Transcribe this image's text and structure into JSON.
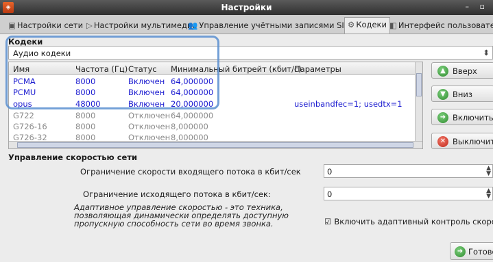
{
  "window": {
    "title": "Настройки",
    "controls": "– ▫"
  },
  "tabs": [
    {
      "label": "Настройки сети",
      "icon": "network-icon",
      "glyph": "▣"
    },
    {
      "label": "Настройки мультимедиа",
      "icon": "play-icon",
      "glyph": "▷"
    },
    {
      "label": "Управление учётными записями SIP",
      "icon": "accounts-icon",
      "glyph": "👥"
    },
    {
      "label": "Кодеки",
      "icon": "codecs-icon",
      "glyph": "⚙"
    },
    {
      "label": "Интерфейс пользователя",
      "icon": "interface-icon",
      "glyph": "◧"
    }
  ],
  "codecs": {
    "section_label": "Кодеки",
    "type_selected": "Аудио кодеки",
    "columns": [
      "Имя",
      "Частота (Гц)",
      "Статус",
      "Минимальный битрейт (кбит/с)",
      "Параметры"
    ],
    "rows": [
      {
        "name": "PCMA",
        "rate": "8000",
        "status": "Включен",
        "bitrate": "64,000000",
        "params": "",
        "enabled": true
      },
      {
        "name": "PCMU",
        "rate": "8000",
        "status": "Включен",
        "bitrate": "64,000000",
        "params": "",
        "enabled": true
      },
      {
        "name": "opus",
        "rate": "48000",
        "status": "Включен",
        "bitrate": "20,000000",
        "params": "useinbandfec=1; usedtx=1",
        "enabled": true
      },
      {
        "name": "G722",
        "rate": "8000",
        "status": "Отключен",
        "bitrate": "64,000000",
        "params": "",
        "enabled": false
      },
      {
        "name": "G726-16",
        "rate": "8000",
        "status": "Отключен",
        "bitrate": "8,000000",
        "params": "",
        "enabled": false
      },
      {
        "name": "G726-32",
        "rate": "8000",
        "status": "Отключен",
        "bitrate": "8,000000",
        "params": "",
        "enabled": false
      }
    ],
    "buttons": {
      "up": "Вверх",
      "down": "Вниз",
      "enable": "Включить",
      "disable": "Выключить"
    }
  },
  "bandwidth": {
    "section_label": "Управление скоростью сети",
    "incoming_label": "Ограничение скорости входящего потока в кбит/сек",
    "incoming_value": "0",
    "outgoing_label": "Ограничение исходящего потока в кбит/сек:",
    "outgoing_value": "0",
    "description": "Адаптивное управление скоростью - это техника, позволяющая динамически определять доступную пропускную способность сети во время звонка.",
    "adaptive_label": "Включить адаптивный контроль скорости",
    "adaptive_checked": true
  },
  "footer": {
    "done_label": "Готово"
  }
}
